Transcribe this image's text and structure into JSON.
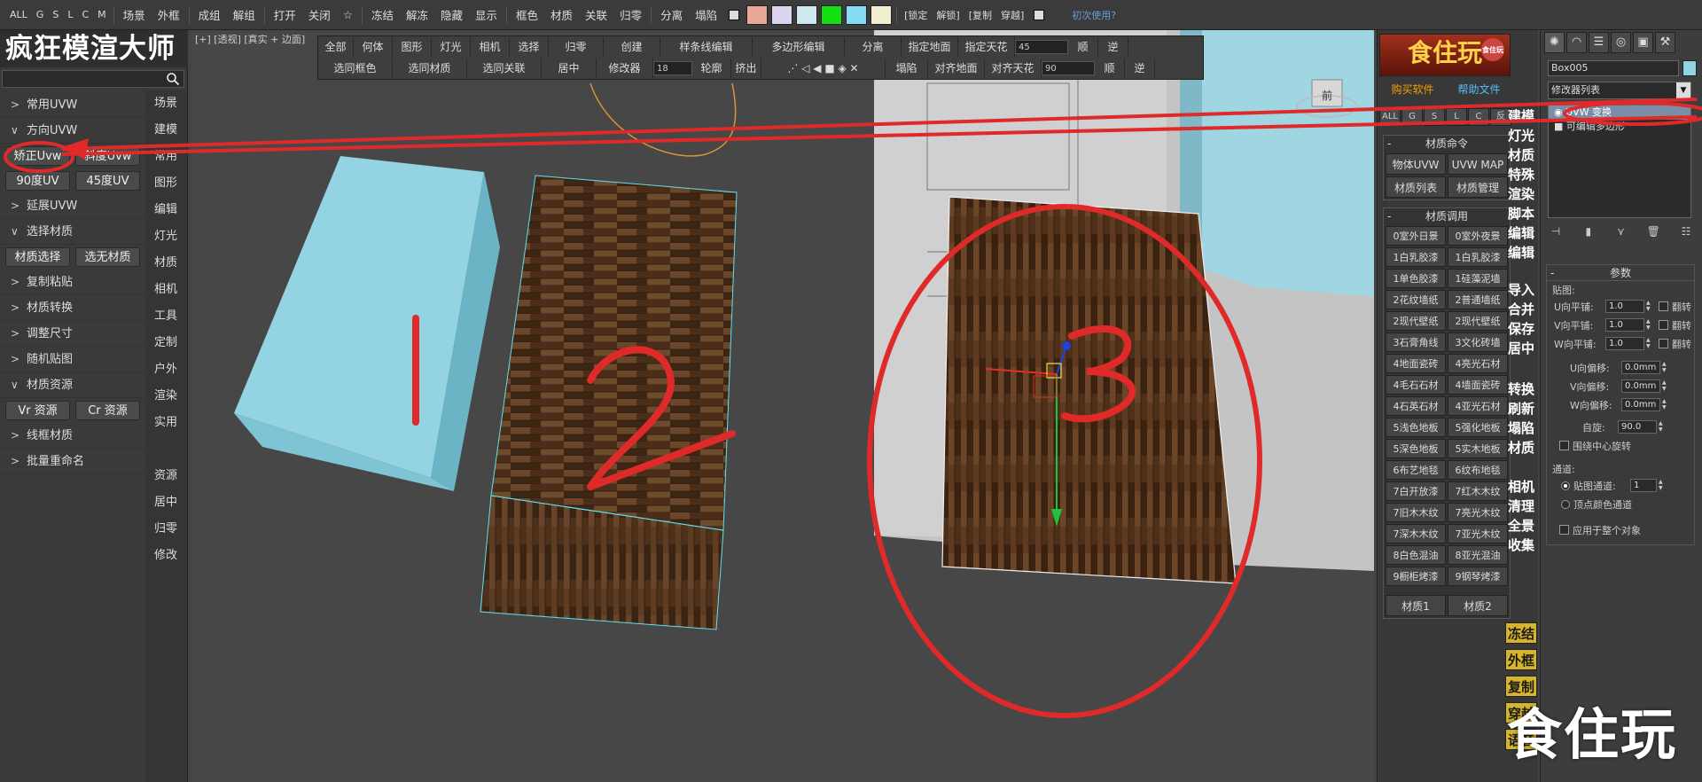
{
  "topbar": {
    "sel_filters": [
      "ALL",
      "G",
      "S",
      "L",
      "C",
      "M"
    ],
    "menu": [
      "场景",
      "外框",
      "成组",
      "解组",
      "打开",
      "关闭"
    ],
    "freeze": [
      "冻结",
      "解冻",
      "隐藏",
      "显示"
    ],
    "mat": [
      "框色",
      "材质",
      "关联",
      "归零"
    ],
    "split": [
      "分离",
      "塌陷"
    ],
    "swatches": [
      "#e9a79a",
      "#dcd4ee",
      "#cde8ef",
      "#13e010",
      "#86dcf4",
      "#f1f1cf"
    ],
    "lock": [
      "[锁定",
      "解锁]",
      "[复制",
      "穿越]"
    ],
    "first_use": "初次使用?"
  },
  "left": {
    "brand": "疯狂模渲大师",
    "categories": [
      {
        "label": "常用UVW",
        "open": false
      },
      {
        "label": "方向UVW",
        "open": true
      },
      {
        "label": "延展UVW",
        "open": false
      },
      {
        "label": "选择材质",
        "open": true
      },
      {
        "label": "复制粘贴",
        "open": false
      },
      {
        "label": "材质转换",
        "open": false
      },
      {
        "label": "调整尺寸",
        "open": false
      },
      {
        "label": "随机贴图",
        "open": false
      },
      {
        "label": "材质资源",
        "open": true
      },
      {
        "label": "线框材质",
        "open": false
      },
      {
        "label": "批量重命名",
        "open": false
      }
    ],
    "uvw_buttons": [
      "矫正Uvw",
      "斜度Uvw",
      "90度UV",
      "45度UV"
    ],
    "mat_select_buttons": [
      "材质选择",
      "选无材质"
    ],
    "resource_buttons": [
      "Vr 资源",
      "Cr 资源"
    ],
    "side_items": [
      "场景",
      "建模",
      "常用",
      "图形",
      "编辑",
      "灯光",
      "材质",
      "相机",
      "工具",
      "定制",
      "户外",
      "渲染",
      "实用",
      "",
      "资源",
      "居中",
      "归零",
      "修改"
    ]
  },
  "viewport": {
    "label": "[+] [透视] [真实 + 边面]",
    "cmd_row1": [
      "全部",
      "何体",
      "图形",
      "灯光",
      "相机",
      "选择",
      "归零",
      "创建",
      "样条线编辑",
      "多边形编辑",
      "分离",
      "指定地面",
      "指定天花",
      "45",
      "顺",
      "逆"
    ],
    "cmd_row2": [
      "选同框色",
      "选同材质",
      "选同关联",
      "居中",
      "修改器",
      "18",
      "轮廓",
      "挤出",
      "",
      "塌陷",
      "对齐地面",
      "对齐天花",
      "90",
      "顺",
      "逆"
    ],
    "box_labels": [
      "1",
      "2",
      "3"
    ],
    "nav_label": "前"
  },
  "mid": {
    "logo": "食住玩",
    "logo_badge": "食住玩",
    "buy": "购买软件",
    "help": "帮助文件",
    "filter_minis": [
      "ALL",
      "G",
      "S",
      "L",
      "C",
      "反"
    ],
    "mat_cmd_title": "材质命令",
    "mat_cmd_buttons": [
      "物体UVW",
      "UVW MAP",
      "材质列表",
      "材质管理"
    ],
    "mat_call_title": "材质调用",
    "mat_call_buttons": [
      "0室外日景",
      "0室外夜景",
      "1白乳胶漆",
      "1白乳胶漆",
      "1单色胶漆",
      "1硅藻泥墙",
      "2花纹墙纸",
      "2普通墙纸",
      "2现代壁纸",
      "2现代壁纸",
      "3石膏角线",
      "3文化砖墙",
      "4地面瓷砖",
      "4亮光石材",
      "4毛石石材",
      "4墙面瓷砖",
      "4石英石材",
      "4亚光石材",
      "5浅色地板",
      "5强化地板",
      "5深色地板",
      "5实木地板",
      "6布艺地毯",
      "6纹布地毯",
      "7白开放漆",
      "7红木木纹",
      "7旧木木纹",
      "7亮光木纹",
      "7深木木纹",
      "7亚光木纹",
      "8白色混油",
      "8亚光混油",
      "9橱柜烤漆",
      "9钢琴烤漆"
    ],
    "mat_tabs": [
      "材质1",
      "材质2"
    ],
    "vcol1": [
      "建模",
      "灯光",
      "材质",
      "特殊",
      "渲染",
      "脚本",
      "编辑",
      "编辑"
    ],
    "vcol2": [
      "导入",
      "合并",
      "保存",
      "居中"
    ],
    "vcol3": [
      "转换",
      "刷新",
      "塌陷",
      "材质"
    ],
    "vcol4": [
      "相机",
      "清理",
      "全景",
      "收集"
    ],
    "vcol_yellow": [
      "冻结",
      "外框",
      "复制",
      "穿越",
      "语音"
    ]
  },
  "right": {
    "tab_icons": [
      "sun-icon",
      "curve-icon",
      "hierarchy-icon",
      "motion-icon",
      "display-icon",
      "utility-icon"
    ],
    "object_name": "Box005",
    "object_color": "#8fd4e0",
    "modifier_list": "修改器列表",
    "stack": [
      {
        "label": "UVW 变换",
        "selected": true
      },
      {
        "label": "可编辑多边形",
        "selected": false
      }
    ],
    "params_title": "参数",
    "map_group": "贴图:",
    "rows_a": [
      {
        "label": "U向平铺:",
        "value": "1.0",
        "check": "翻转"
      },
      {
        "label": "V向平铺:",
        "value": "1.0",
        "check": "翻转"
      },
      {
        "label": "W向平铺:",
        "value": "1.0",
        "check": "翻转"
      }
    ],
    "rows_b": [
      {
        "label": "U向偏移:",
        "value": "0.0mm"
      },
      {
        "label": "V向偏移:",
        "value": "0.0mm"
      },
      {
        "label": "W向偏移:",
        "value": "0.0mm"
      }
    ],
    "spin_label": "自旋:",
    "spin_value": "90.0",
    "rotate_center": "围绕中心旋转",
    "channel_group": "通道:",
    "map_channel_label": "贴图通道:",
    "map_channel_value": "1",
    "vertex_color": "顶点颜色通道",
    "apply_all": "应用于整个对象"
  },
  "watermark": "食住玩"
}
